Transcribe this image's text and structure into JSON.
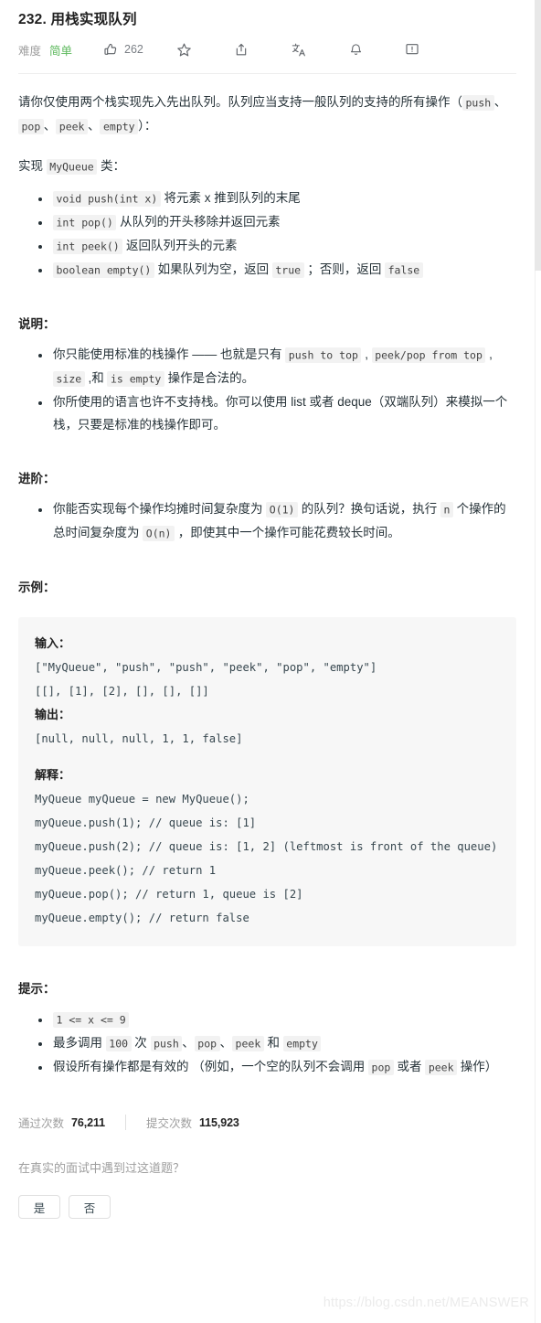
{
  "header": {
    "title": "232. 用栈实现队列",
    "difficulty_label": "难度",
    "difficulty_value": "简单",
    "like_count": "262",
    "icons": {
      "like": "thumbs-up-icon",
      "favorite": "star-icon",
      "share": "share-icon",
      "translate": "translate-icon",
      "notify": "bell-icon",
      "feedback": "comment-icon"
    }
  },
  "description": {
    "paragraph1_a": "请你仅使用两个栈实现先入先出队列。队列应当支持一般队列的支持的所有操作（",
    "code_push": "push",
    "sep1": "、",
    "code_pop": "pop",
    "sep2": "、",
    "code_peek": "peek",
    "sep3": "、",
    "code_empty": "empty",
    "paragraph1_b": "）：",
    "paragraph2_a": "实现 ",
    "code_class": "MyQueue",
    "paragraph2_b": " 类：",
    "methods": [
      {
        "code": "void push(int x)",
        "text": " 将元素 x 推到队列的末尾"
      },
      {
        "code": "int pop()",
        "text": " 从队列的开头移除并返回元素"
      },
      {
        "code": "int peek()",
        "text": " 返回队列开头的元素"
      }
    ],
    "method_empty": {
      "code": "boolean empty()",
      "text_a": " 如果队列为空，返回 ",
      "code_true": "true",
      "text_b": " ；否则，返回 ",
      "code_false": "false"
    }
  },
  "notes": {
    "heading": "说明：",
    "item1_a": "你只能使用标准的栈操作 —— 也就是只有 ",
    "item1_code1": "push to top",
    "item1_b": " , ",
    "item1_code2": "peek/pop from top",
    "item1_c": " , ",
    "item1_code3": "size",
    "item1_d": " ,和 ",
    "item1_code4": "is empty",
    "item1_e": " 操作是合法的。",
    "item2": "你所使用的语言也许不支持栈。你可以使用 list 或者 deque（双端队列）来模拟一个栈，只要是标准的栈操作即可。"
  },
  "advanced": {
    "heading": "进阶：",
    "item_a": "你能否实现每个操作均摊时间复杂度为 ",
    "item_code1": "O(1)",
    "item_b": " 的队列？换句话说，执行 ",
    "item_code2": "n",
    "item_c": " 个操作的总时间复杂度为 ",
    "item_code3": "O(n)",
    "item_d": " ，即使其中一个操作可能花费较长时间。"
  },
  "example": {
    "heading": "示例：",
    "input_label": "输入：",
    "input_line1": "[\"MyQueue\", \"push\", \"push\", \"peek\", \"pop\", \"empty\"]",
    "input_line2": "[[], [1], [2], [], [], []]",
    "output_label": "输出：",
    "output_line": "[null, null, null, 1, 1, false]",
    "explain_label": "解释：",
    "explain_lines": [
      "MyQueue myQueue = new MyQueue();",
      "myQueue.push(1); // queue is: [1]",
      "myQueue.push(2); // queue is: [1, 2] (leftmost is front of the queue)",
      "myQueue.peek(); // return 1",
      "myQueue.pop(); // return 1, queue is [2]",
      "myQueue.empty(); // return false"
    ]
  },
  "hints": {
    "heading": "提示：",
    "item1_code": "1 <= x <= 9",
    "item2_a": "最多调用 ",
    "item2_code1": "100",
    "item2_b": " 次 ",
    "item2_code2": "push",
    "item2_c": "、",
    "item2_code3": "pop",
    "item2_d": "、",
    "item2_code4": "peek",
    "item2_e": " 和 ",
    "item2_code5": "empty",
    "item3_a": "假设所有操作都是有效的 （例如，一个空的队列不会调用 ",
    "item3_code1": "pop",
    "item3_b": " 或者 ",
    "item3_code2": "peek",
    "item3_c": " 操作）"
  },
  "stats": {
    "passed_label": "通过次数",
    "passed_value": "76,211",
    "submitted_label": "提交次数",
    "submitted_value": "115,923"
  },
  "footer": {
    "interview_question": "在真实的面试中遇到过这道题？",
    "yes_label": "是",
    "no_label": "否"
  },
  "watermark": "https://blog.csdn.net/MEANSWER",
  "colors": {
    "difficulty_easy": "#5cb85c",
    "text": "#263238",
    "muted": "#9e9e9e",
    "code_bg": "#f2f2f2",
    "block_bg": "#f7f7f7"
  }
}
